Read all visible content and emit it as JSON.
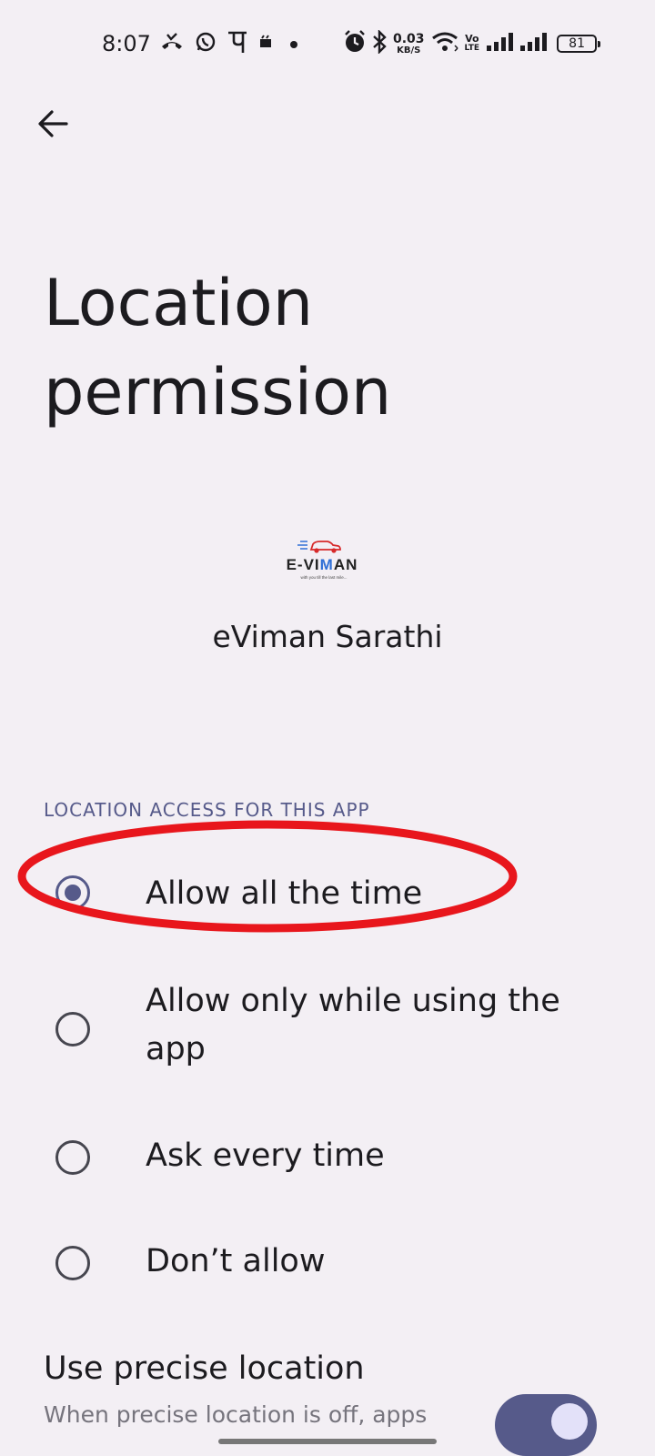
{
  "status_bar": {
    "time": "8:07",
    "network_speed": "0.03",
    "network_speed_unit": "KB/S",
    "volte_top": "Vo",
    "volte_bottom": "LTE",
    "battery": "81",
    "icons_left": [
      "missed-call-icon",
      "whatsapp-icon",
      "phonepe-icon",
      "notification-icon",
      "dot-icon"
    ],
    "icons_right": [
      "alarm-icon",
      "bluetooth-icon",
      "wifi-icon",
      "signal-icon",
      "signal-icon"
    ]
  },
  "header": {
    "title": "Location permission"
  },
  "app": {
    "logo_text": "E-VIMAN",
    "logo_tagline": "with you till the last mile...",
    "name": "eViman Sarathi"
  },
  "location_access": {
    "section_title": "LOCATION ACCESS FOR THIS APP",
    "selected_index": 0,
    "options": [
      {
        "label": "Allow all the time",
        "selected": true
      },
      {
        "label": "Allow only while using the app",
        "selected": false
      },
      {
        "label": "Ask every time",
        "selected": false
      },
      {
        "label": "Don’t allow",
        "selected": false
      }
    ]
  },
  "precise_location": {
    "title": "Use precise location",
    "description": "When precise location is off, apps",
    "enabled": true
  },
  "colors": {
    "background": "#f3eff4",
    "accent": "#565a8a",
    "annotation": "#e8161c"
  }
}
